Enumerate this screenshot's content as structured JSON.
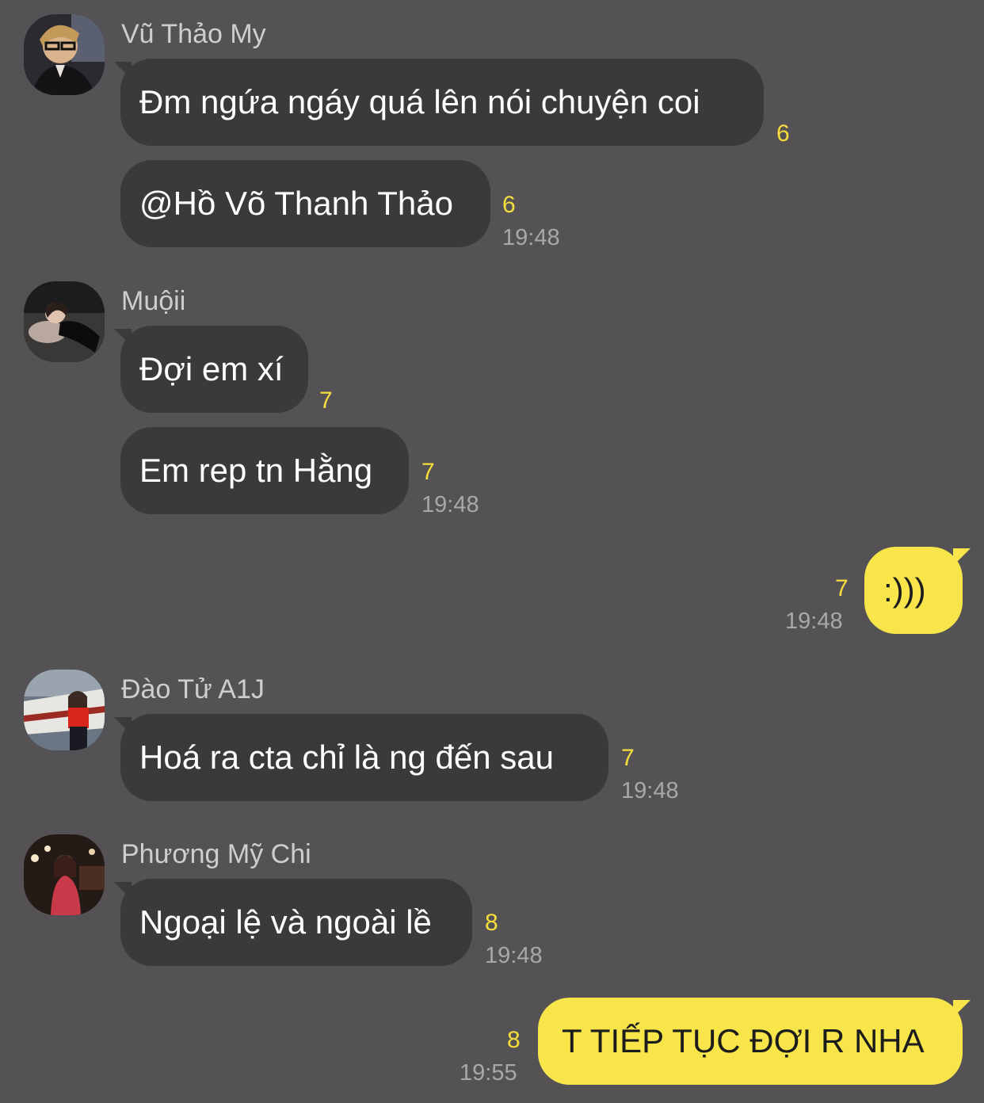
{
  "messages": [
    {
      "sender": "Vũ Thảo My",
      "text": "Đm ngứa ngáy quá lên nói chuyện coi",
      "count": "6"
    },
    {
      "text": "@Hồ Võ Thanh Thảo",
      "count": "6",
      "time": "19:48"
    },
    {
      "sender": "Muộii",
      "text": "Đợi em xí",
      "count": "7"
    },
    {
      "text": "Em rep tn Hằng",
      "count": "7",
      "time": "19:48"
    },
    {
      "text": ":)))",
      "count": "7",
      "time": "19:48"
    },
    {
      "sender": "Đào Tử A1J",
      "text": "Hoá ra cta chỉ là ng đến sau",
      "count": "7",
      "time": "19:48"
    },
    {
      "sender": "Phương Mỹ Chi",
      "text": "Ngoại lệ và ngoài lề",
      "count": "8",
      "time": "19:48"
    },
    {
      "text": "T TIẾP TỤC ĐỢI R NHA",
      "count": "8",
      "time": "19:55"
    }
  ],
  "colors": {
    "background": "#545254",
    "incoming_bubble": "#3a393b",
    "outgoing_bubble": "#f8e54a",
    "unread_count": "#f5de3c"
  }
}
